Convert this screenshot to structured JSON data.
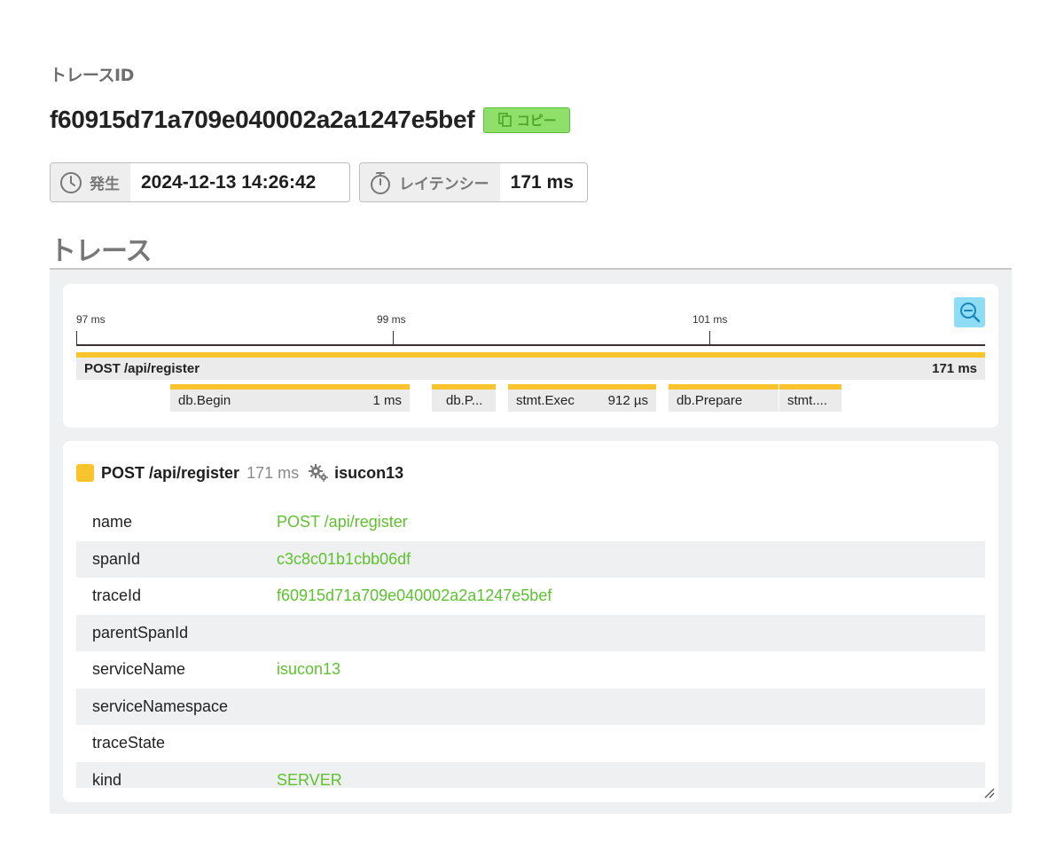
{
  "header": {
    "trace_id_label": "トレースID",
    "trace_id": "f60915d71a709e040002a2a1247e5bef",
    "copy_label": "コピー"
  },
  "occurred": {
    "label": "発生",
    "value": "2024-12-13 14:26:42",
    "icon": "clock-icon"
  },
  "latency": {
    "label": "レイテンシー",
    "value": "171 ms",
    "icon": "stopwatch-icon"
  },
  "section_title": "トレース",
  "timeline": {
    "ticks": [
      "97 ms",
      "99 ms",
      "101 ms"
    ],
    "zoom_icon": "zoom-out-icon",
    "root_span": {
      "name": "POST /api/register",
      "duration": "171 ms"
    },
    "child_spans": [
      {
        "name": "db.Begin",
        "duration": "1 ms"
      },
      {
        "name": "",
        "duration": ""
      },
      {
        "name": "db.P...",
        "duration": ""
      },
      {
        "name": "stmt.Exec",
        "duration": "912 µs"
      },
      {
        "name": "db.Prepare",
        "duration": ""
      },
      {
        "name": "stmt....",
        "duration": ""
      }
    ]
  },
  "detail": {
    "span_name": "POST /api/register",
    "span_duration": "171 ms",
    "service_icon": "gears-icon",
    "service": "isucon13",
    "color": "#fbc42c",
    "attributes": [
      {
        "key": "name",
        "value": "POST /api/register"
      },
      {
        "key": "spanId",
        "value": "c3c8c01b1cbb06df"
      },
      {
        "key": "traceId",
        "value": "f60915d71a709e040002a2a1247e5bef"
      },
      {
        "key": "parentSpanId",
        "value": ""
      },
      {
        "key": "serviceName",
        "value": "isucon13"
      },
      {
        "key": "serviceNamespace",
        "value": ""
      },
      {
        "key": "traceState",
        "value": ""
      },
      {
        "key": "kind",
        "value": "SERVER"
      }
    ]
  },
  "colors": {
    "accent_green": "#5fc12f",
    "span_yellow": "#fbc42c",
    "zoom_blue": "#8fdcf5"
  }
}
